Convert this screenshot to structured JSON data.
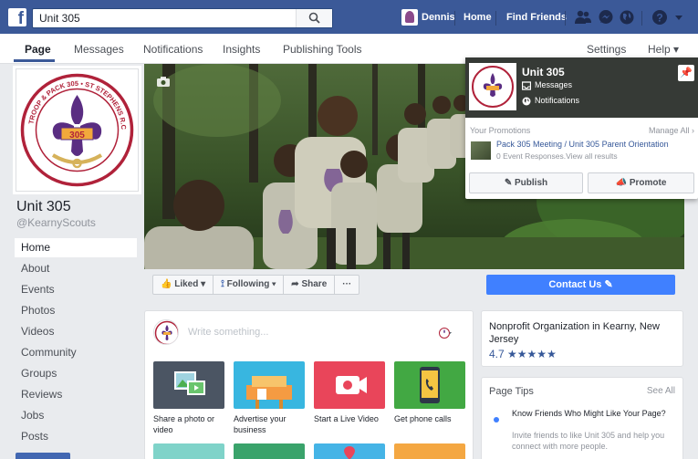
{
  "topbar": {
    "search_value": "Unit 305",
    "user_name": "Dennis",
    "home_label": "Home",
    "find_friends_label": "Find Friends",
    "icons": [
      "friend-requests-icon",
      "messages-icon",
      "notifications-globe-icon",
      "help-icon",
      "account-menu-icon"
    ],
    "brand_color": "#3b5998"
  },
  "nav": {
    "tabs": [
      "Page",
      "Messages",
      "Notifications",
      "Insights",
      "Publishing Tools"
    ],
    "settings_label": "Settings",
    "help_label": "Help ▾",
    "active_tab": "Page"
  },
  "page": {
    "name": "Unit 305",
    "handle": "@KearnyScouts",
    "logo_text": "TROOP & PACK 305 • ST STEPHENS R.C.C.",
    "logo_number": "305"
  },
  "sidebar": {
    "items": [
      "Home",
      "About",
      "Events",
      "Photos",
      "Videos",
      "Community",
      "Groups",
      "Reviews",
      "Jobs",
      "Posts"
    ],
    "active_item": "Home"
  },
  "promo": {
    "title": "Unit 305",
    "messages_label": "Messages",
    "notifications_label": "Notifications",
    "your_promotions": "Your Promotions",
    "manage_all": "Manage All ›",
    "event_title": "Pack 305 Meeting / Unit 305 Parent Orientation",
    "event_stats": "0 Event Responses.View all results",
    "publish_label": "Publish",
    "promote_label": "Promote"
  },
  "actions": {
    "liked_label": "Liked ▾",
    "following_label": "Following ▾",
    "share_label": "Share",
    "more_label": "···",
    "contact_label": "Contact Us"
  },
  "composer": {
    "placeholder": "Write something...",
    "tiles": [
      {
        "label": "Share a photo or video",
        "color": "#4b5563"
      },
      {
        "label": "Advertise your business",
        "color": "#38b6e0"
      },
      {
        "label": "Start a Live Video",
        "color": "#e9455a"
      },
      {
        "label": "Get phone calls",
        "color": "#42a843"
      }
    ]
  },
  "info": {
    "org": "Nonprofit Organization in Kearny, New Jersey",
    "rating": "4.7",
    "stars": "★★★★★"
  },
  "tips": {
    "title": "Page Tips",
    "see_all": "See All",
    "question": "Know Friends Who Might Like Your Page?",
    "description": "Invite friends to like Unit 305 and help you connect with more people."
  }
}
